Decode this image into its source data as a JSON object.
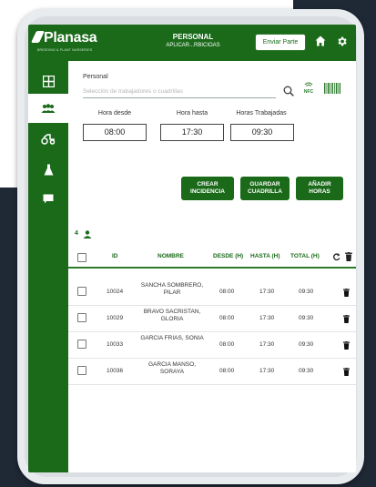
{
  "header": {
    "logo_text": "Planasa",
    "logo_tagline": "BREEDING & PLANT NURSERIES",
    "title": "PERSONAL",
    "subtitle": "APLICAR...RBICIOAS",
    "send_button": "Enviar Parte",
    "home_icon": "home-icon",
    "settings_icon": "gear-icon"
  },
  "sidebar": {
    "items": [
      {
        "icon": "grid-icon",
        "active": false
      },
      {
        "icon": "people-icon",
        "active": true
      },
      {
        "icon": "tractor-icon",
        "active": false
      },
      {
        "icon": "flask-icon",
        "active": false
      },
      {
        "icon": "chat-icon",
        "active": false
      }
    ]
  },
  "form": {
    "personal_label": "Personal",
    "search_placeholder": "Selección de trabajadores o cuadrillas",
    "hora_desde_label": "Hora desde",
    "hora_hasta_label": "Hora hasta",
    "horas_trabajadas_label": "Horas Trabajadas",
    "hora_desde": "08:00",
    "hora_hasta": "17:30",
    "horas_trabajadas": "09:30",
    "nfc_label": "NFC"
  },
  "actions": {
    "crear_incidencia": "CREAR INCIDENCIA",
    "guardar_cuadrilla": "GUARDAR CUADRILLA",
    "anadir_horas": "AÑADIR HORAS"
  },
  "table": {
    "count": "4",
    "columns": [
      "ID",
      "NOMBRE",
      "DESDE (H)",
      "HASTA (H)",
      "TOTAL (H)"
    ],
    "rows": [
      {
        "id": "10024",
        "name": "SANCHA SOMBRERO, PILAR",
        "desde": "08:00",
        "hasta": "17:30",
        "total": "09:30"
      },
      {
        "id": "10029",
        "name": "BRAVO SACRISTAN, GLORIA",
        "desde": "08:00",
        "hasta": "17:30",
        "total": "09:30"
      },
      {
        "id": "10033",
        "name": "GARCIA FRIAS, SONIA",
        "desde": "08:00",
        "hasta": "17:30",
        "total": "09:30"
      },
      {
        "id": "10036",
        "name": "GARCIA MANSO, SORAYA",
        "desde": "08:00",
        "hasta": "17:30",
        "total": "09:30"
      }
    ]
  },
  "colors": {
    "brand_green": "#1a6a1a",
    "background_dark": "#1f2936"
  }
}
